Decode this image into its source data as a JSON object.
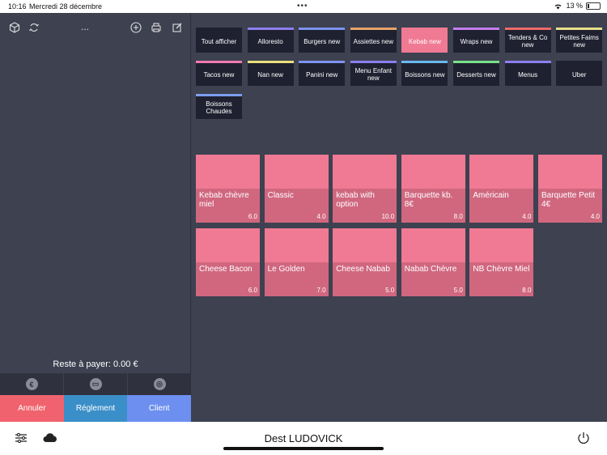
{
  "status_bar": {
    "time": "10:16",
    "date": "Mercredi 28 décembre",
    "dots": "•••",
    "battery": "13 %",
    "battery_level_percent": 13
  },
  "left_panel": {
    "toolbar": {
      "dots": "...",
      "icons": [
        "cube-icon",
        "sync-icon",
        "add-circle-icon",
        "printer-icon",
        "edit-icon"
      ]
    },
    "remaining_label": "Reste à payer: 0.00 €",
    "payment_icons": [
      "cash-icon",
      "card-icon",
      "nfc-icon"
    ],
    "payment_icon_glyphs": [
      "€",
      "▭",
      "◎"
    ],
    "actions": {
      "cancel": "Annuler",
      "payment": "Réglement",
      "client": "Client"
    }
  },
  "categories": [
    {
      "label": "Tout afficher",
      "color": "#1f2130",
      "active": false
    },
    {
      "label": "Alloresto",
      "color": "#8d7ef0",
      "active": false
    },
    {
      "label": "Burgers new",
      "color": "#7d93f0",
      "active": false
    },
    {
      "label": "Assiettes new",
      "color": "#e8a46a",
      "active": false
    },
    {
      "label": "Kebab new",
      "color": "#f07a93",
      "active": true
    },
    {
      "label": "Wraps new",
      "color": "#c47ef0",
      "active": false
    },
    {
      "label": "Tenders & Co new",
      "color": "#f06a6a",
      "active": false
    },
    {
      "label": "Petites Faims new",
      "color": "#e8e08a",
      "active": false
    },
    {
      "label": "Tacos new",
      "color": "#f07ab0",
      "active": false
    },
    {
      "label": "Nan new",
      "color": "#e8e07a",
      "active": false
    },
    {
      "label": "Panini new",
      "color": "#7d93f0",
      "active": false
    },
    {
      "label": "Menu Enfant new",
      "color": "#8d7ef0",
      "active": false
    },
    {
      "label": "Boissons new",
      "color": "#6ab8f0",
      "active": false
    },
    {
      "label": "Desserts new",
      "color": "#7ae08a",
      "active": false
    },
    {
      "label": "Menus",
      "color": "#8d7ef0",
      "active": false
    },
    {
      "label": "Uber",
      "color": "#1f2130",
      "active": false
    },
    {
      "label": "Boissons Chaudes",
      "color": "#7d9ef0",
      "active": false
    }
  ],
  "products": [
    {
      "name": "Kebab chèvre miel",
      "price": "6.0"
    },
    {
      "name": "Classic",
      "price": "4.0"
    },
    {
      "name": "kebab with option",
      "price": "10.0"
    },
    {
      "name": "Barquette kb. 8€",
      "price": "8.0"
    },
    {
      "name": "Américain",
      "price": "4.0"
    },
    {
      "name": "Barquette Petit 4€",
      "price": "4.0"
    },
    {
      "name": "Cheese Bacon",
      "price": "6.0"
    },
    {
      "name": "Le Golden",
      "price": "7.0"
    },
    {
      "name": "Cheese Nabab",
      "price": "5.0"
    },
    {
      "name": "Nabab Chèvre",
      "price": "5.0"
    },
    {
      "name": "NB Chèvre Miel",
      "price": "8.0"
    }
  ],
  "bottom_bar": {
    "user_name": "Dest LUDOVICK",
    "icons": [
      "settings-sliders-icon",
      "cloud-icon",
      "power-icon"
    ]
  }
}
